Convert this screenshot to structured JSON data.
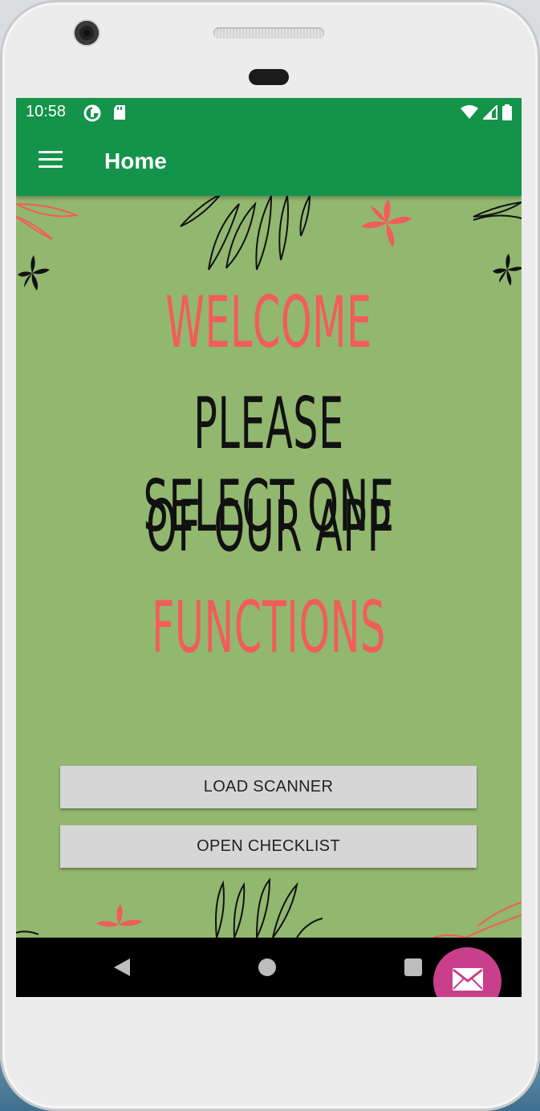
{
  "status_bar": {
    "time": "10:58",
    "icons": [
      "data-saver-icon",
      "sd-card-icon",
      "wifi-icon",
      "signal-icon",
      "battery-icon"
    ]
  },
  "app_bar": {
    "title": "Home",
    "menu_icon": "hamburger-menu-icon"
  },
  "welcome": {
    "line1": "WELCOME",
    "line2": "PLEASE SELECT ONE",
    "line3": "OF OUR APP",
    "line4": "FUNCTIONS"
  },
  "buttons": {
    "load_scanner": "LOAD SCANNER",
    "open_checklist": "OPEN CHECKLIST"
  },
  "fab": {
    "icon": "mail-icon"
  },
  "nav_bar": {
    "icons": [
      "back-icon",
      "home-icon",
      "recents-icon"
    ]
  },
  "colors": {
    "appbar": "#14934a",
    "background": "#92b76f",
    "accent_red": "#f25c5a",
    "fab": "#c93f8b",
    "button": "#d6d6d6"
  }
}
